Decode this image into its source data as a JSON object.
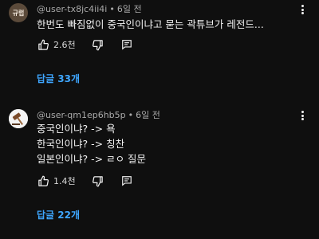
{
  "comments": [
    {
      "avatar_text": "규럽",
      "username": "@user-tx8jc4ii4i",
      "time": "6일 전",
      "lines": [
        "한번도 빠짐없이 중국인이냐고 묻는 곽튜브가 레전드..."
      ],
      "likes": "2.6천",
      "replies": "답글 33개"
    },
    {
      "username": "@user-qm1ep6hb5p",
      "time": "6일 전",
      "lines": [
        "중국인이냐? -> 욕",
        "한국인이냐? -> 칭찬",
        "일본인이냐? -> ㄹㅇ 질문"
      ],
      "likes": "1.4천",
      "replies": "답글 22개"
    }
  ],
  "icons": {
    "like": "thumb-up-icon",
    "dislike": "thumb-down-icon",
    "reply": "comment-icon",
    "more": "more-vertical-icon"
  },
  "colors": {
    "background": "#0f0f0f",
    "replies_link": "#3ea6ff",
    "meta_text": "#aaaaaa"
  }
}
